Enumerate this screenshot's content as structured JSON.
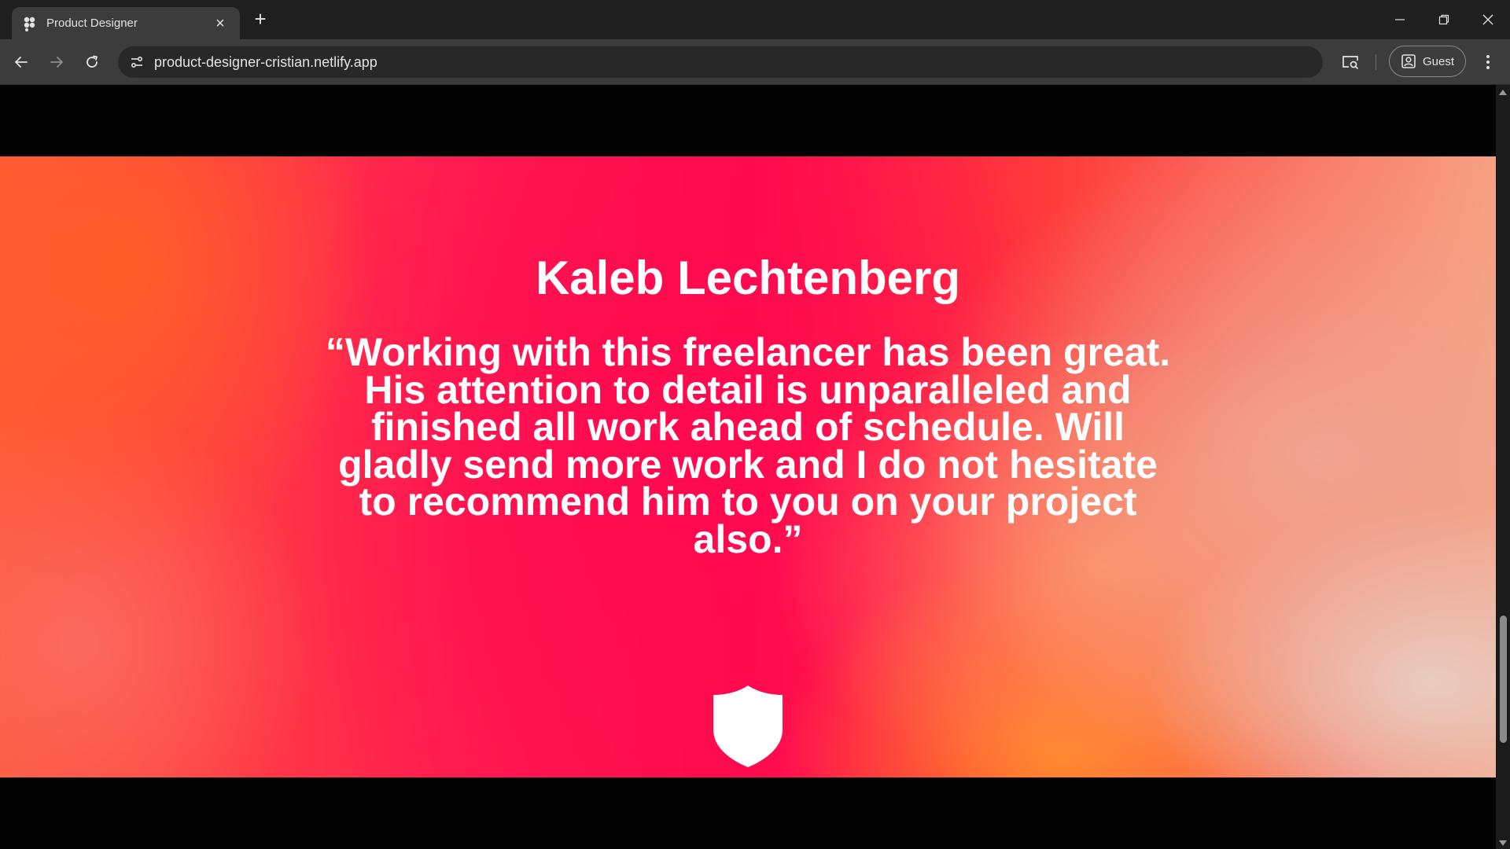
{
  "browser": {
    "tab": {
      "title": "Product Designer",
      "favicon": "netlify-figma-like-icon"
    },
    "address_bar": {
      "url": "product-designer-cristian.netlify.app"
    },
    "profile": {
      "label": "Guest"
    }
  },
  "testimonial": {
    "name": "Kaleb Lechtenberg",
    "quote": "“Working with this freelancer has been great. His attention to detail is unparalleled and finished all work ahead of schedule. Will gladly send more work and I do not hesitate to recommend him to you on your project also.”",
    "badge_icon": "shield-icon"
  },
  "colors": {
    "chrome_dark": "#1f1f1f",
    "chrome_mid": "#3c3c3c",
    "hero_pink": "#ff0a4e",
    "hero_orange": "#ff8c28",
    "text": "#ffffff"
  }
}
